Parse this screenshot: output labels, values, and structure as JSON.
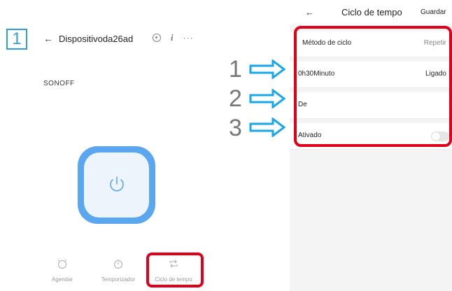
{
  "left_screen": {
    "step_number": "1",
    "title": "Dispositivoda26ad",
    "brand": "SONOFF",
    "icons": [
      "back-arrow-icon",
      "camera-icon",
      "info-icon",
      "more-icon",
      "power-icon"
    ],
    "tabs": [
      {
        "label": "Agendar",
        "icon": "alarm-clock-icon"
      },
      {
        "label": "Temporizador",
        "icon": "stopwatch-icon"
      },
      {
        "label": "Ciclo de tempo",
        "icon": "repeat-icon"
      }
    ]
  },
  "annotations": {
    "numbers": [
      "1",
      "2",
      "3"
    ],
    "arrow_color": "#1aa7e8",
    "highlight_color": "#e1001a"
  },
  "right_screen": {
    "back": "←",
    "title": "Ciclo de tempo",
    "save_label": "Guardar",
    "rows": [
      {
        "label": "Método de ciclo",
        "value": "Repetir"
      },
      {
        "label": "0h30Minuto",
        "value": "Ligado"
      },
      {
        "label": "De",
        "value": ""
      },
      {
        "label": "Ativado",
        "value": ""
      }
    ]
  },
  "colors": {
    "power_button": "#5aa7ef",
    "accent_blue": "#2ea0d8"
  }
}
